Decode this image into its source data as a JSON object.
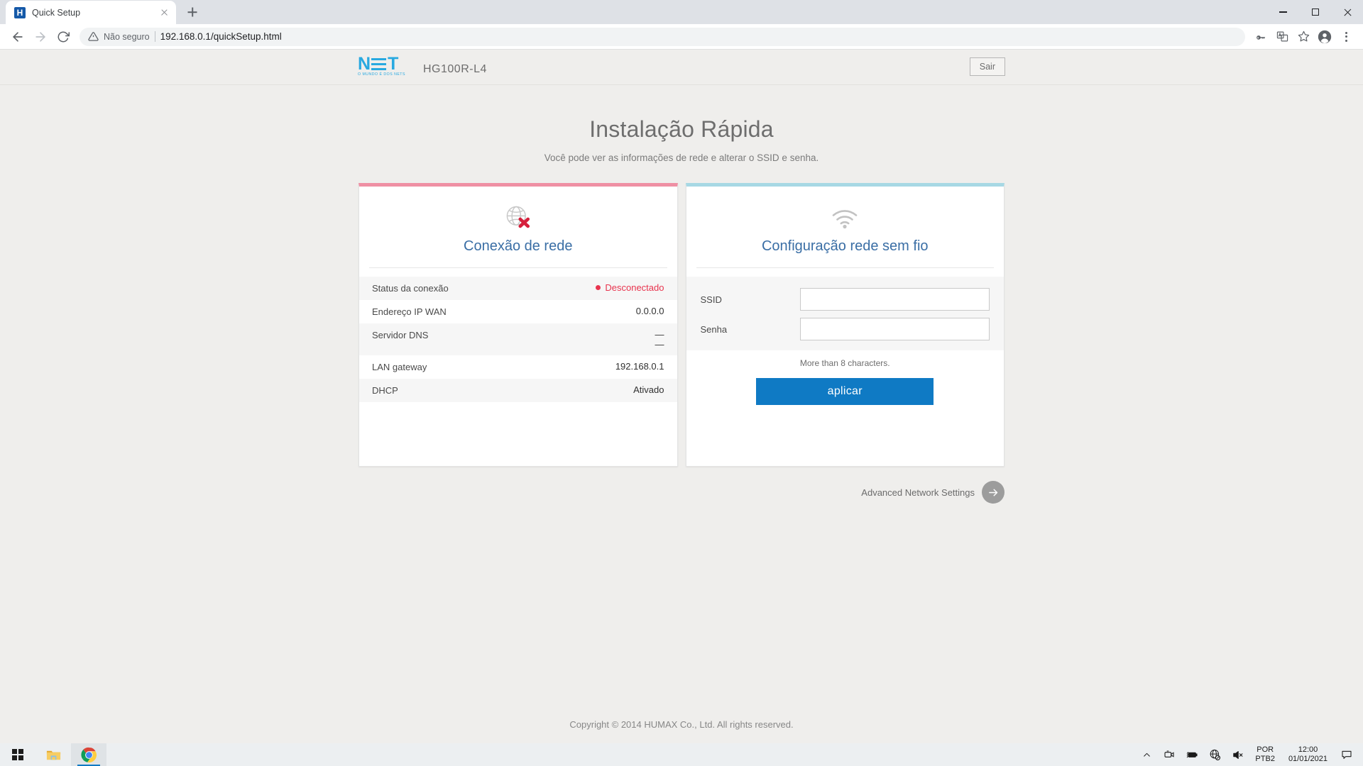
{
  "browser": {
    "tab": {
      "title": "Quick Setup",
      "favicon_letter": "H",
      "favicon_name": "humax-favicon"
    },
    "new_tab_label": "+",
    "window_controls": {
      "minimize": "minimize",
      "maximize": "restore",
      "close": "close"
    },
    "omnibox": {
      "security_text": "Não seguro",
      "url": "192.168.0.1/quickSetup.html"
    },
    "toolbar_icons": [
      "back-arrow-icon",
      "forward-arrow-icon",
      "reload-icon",
      "warning-icon",
      "password-key-icon",
      "translate-icon",
      "bookmark-star-icon",
      "profile-avatar-icon",
      "three-dot-menu-icon"
    ]
  },
  "header": {
    "logo_text": "NET",
    "logo_tagline": "O MUNDO É DOS NETS",
    "model": "HG100R-L4",
    "logout_label": "Sair"
  },
  "main": {
    "title": "Instalação Rápida",
    "subtitle": "Você pode ver as informações de rede e alterar o SSID e senha."
  },
  "network_card": {
    "accent_color": "#ef90a4",
    "icon": "globe-disconnected-icon",
    "title": "Conexão de rede",
    "rows": [
      {
        "label": "Status da conexão",
        "value": "Desconectado",
        "is_status": true
      },
      {
        "label": "Endereço IP WAN",
        "value": "0.0.0.0"
      },
      {
        "label": "Servidor DNS",
        "value": "—\n—"
      },
      {
        "label": "LAN gateway",
        "value": "192.168.0.1"
      },
      {
        "label": "DHCP",
        "value": "Ativado"
      }
    ],
    "status_color": "#e8344e"
  },
  "wireless_card": {
    "accent_color": "#a7d8e4",
    "icon": "wifi-icon",
    "title": "Configuração rede sem fio",
    "fields": [
      {
        "label": "SSID",
        "value": "",
        "placeholder": ""
      },
      {
        "label": "Senha",
        "value": "",
        "placeholder": ""
      }
    ],
    "hint": "More than 8 characters.",
    "apply_label": "aplicar",
    "apply_color": "#0f7ac4"
  },
  "advanced": {
    "label": "Advanced Network Settings",
    "icon": "arrow-right-icon"
  },
  "footer": {
    "copyright": "Copyright © 2014 HUMAX Co., Ltd. All rights reserved."
  },
  "taskbar": {
    "start": "windows-start-icon",
    "apps": [
      "file-explorer-icon",
      "chrome-icon"
    ],
    "tray_icons": [
      "chevron-up-icon",
      "webcam-icon",
      "battery-icon",
      "network-disconnected-icon",
      "speaker-muted-icon"
    ],
    "language": {
      "line1": "POR",
      "line2": "PTB2"
    },
    "clock": {
      "time": "12:00",
      "date": "01/01/2021"
    },
    "notifications": "notification-icon"
  }
}
